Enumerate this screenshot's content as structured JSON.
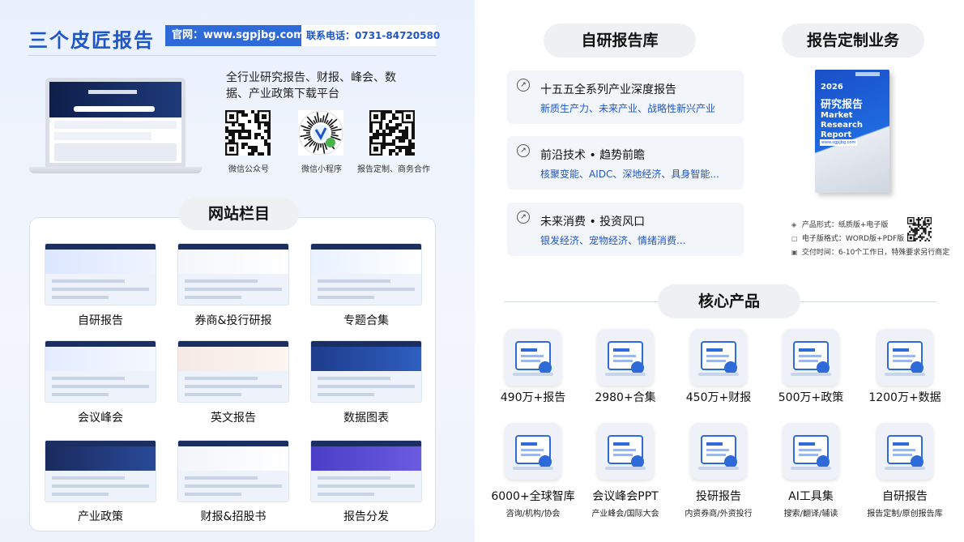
{
  "brand": {
    "name": "三个皮匠报告",
    "website": "官网：www.sgpjbg.com",
    "phone": "联系电话：0731-84720580"
  },
  "intro": {
    "description": "全行业研究报告、财报、峰会、数据、产业政策下载平台",
    "qrcodes": [
      {
        "caption": "微信公众号"
      },
      {
        "caption": "微信小程序"
      },
      {
        "caption": "报告定制、商务合作"
      }
    ]
  },
  "site_sections": {
    "title": "网站栏目",
    "items": [
      {
        "label": "自研报告"
      },
      {
        "label": "券商&投行研报"
      },
      {
        "label": "专题合集"
      },
      {
        "label": "会议峰会"
      },
      {
        "label": "英文报告"
      },
      {
        "label": "数据图表"
      },
      {
        "label": "产业政策"
      },
      {
        "label": "财报&招股书"
      },
      {
        "label": "报告分发"
      }
    ]
  },
  "research_library": {
    "title": "自研报告库",
    "cards": [
      {
        "heading": "十五五全系列产业深度报告",
        "sub": "新质生产力、未来产业、战略性新兴产业"
      },
      {
        "heading": "前沿技术 • 趋势前瞻",
        "sub": "核聚变能、AIDC、深地经济、具身智能..."
      },
      {
        "heading": "未来消费 • 投资风口",
        "sub": "银发经济、宠物经济、情绪消费..."
      }
    ]
  },
  "custom_service": {
    "title": "报告定制业务",
    "book": {
      "year": "2026",
      "title_cn": "研究报告",
      "title_en": "Market Research Report",
      "url": "www.sgpjbg.com"
    },
    "specs": [
      {
        "icon": "layers-icon",
        "text": "产品形式：纸质版+电子版"
      },
      {
        "icon": "document-icon",
        "text": "电子版格式：WORD版+PDF版"
      },
      {
        "icon": "calendar-icon",
        "text": "交付时间：6-10个工作日，特殊要求另行商定"
      }
    ]
  },
  "core_products": {
    "title": "核心产品",
    "items": [
      {
        "label": "490万+报告",
        "sub": "",
        "icon": "book-download-icon"
      },
      {
        "label": "2980+合集",
        "sub": "",
        "icon": "folder-search-icon"
      },
      {
        "label": "450万+财报",
        "sub": "",
        "icon": "rocket-laptop-icon"
      },
      {
        "label": "500万+政策",
        "sub": "",
        "icon": "policy-check-icon"
      },
      {
        "label": "1200万+数据",
        "sub": "",
        "icon": "data-chart-icon"
      },
      {
        "label": "6000+全球智库",
        "sub": "咨询/机构/协会",
        "icon": "world-map-icon"
      },
      {
        "label": "会议峰会PPT",
        "sub": "产业峰会/国际大会",
        "icon": "meeting-icon"
      },
      {
        "label": "投研报告",
        "sub": "内资券商/外资投行",
        "icon": "research-report-icon"
      },
      {
        "label": "AI工具集",
        "sub": "搜索/翻译/辅读",
        "icon": "ai-robot-icon"
      },
      {
        "label": "自研报告",
        "sub": "报告定制/原创报告库",
        "icon": "code-doc-icon"
      }
    ]
  },
  "colors": {
    "brand_blue": "#1f56c7",
    "accent_blue": "#2f6ad9",
    "navy": "#1b2e62"
  }
}
